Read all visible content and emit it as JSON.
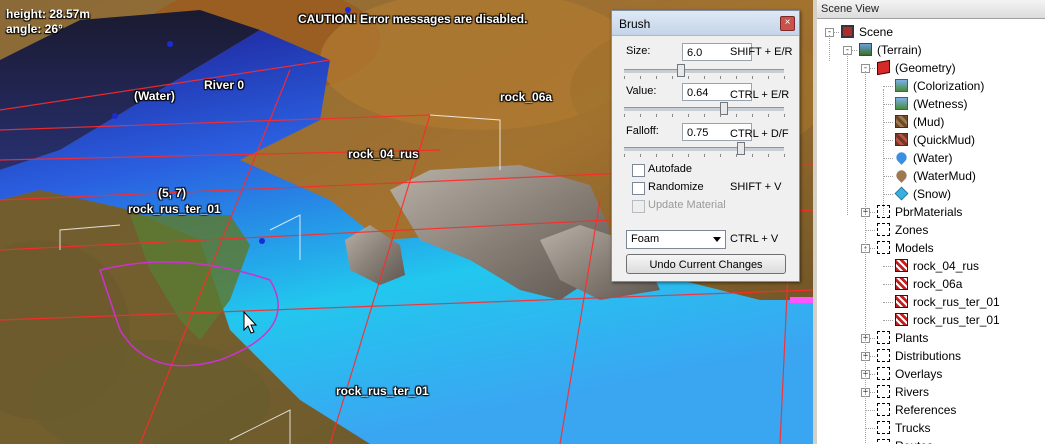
{
  "viewport": {
    "hud": {
      "height": "height: 28.57m",
      "angle": "angle: 26°"
    },
    "caution": "CAUTION! Error messages are disabled.",
    "labels": {
      "water": "(Water)",
      "river": "River 0",
      "rock_06a": "rock_06a",
      "rock_04_rus": "rock_04_rus",
      "coords": "(5, 7)",
      "rock_rus_ter_01_a": "rock_rus_ter_01",
      "rock_rus_ter_01_b": "rock_rus_ter_01"
    }
  },
  "brush": {
    "title": "Brush",
    "close": "×",
    "size": {
      "label": "Size:",
      "value": "6.0",
      "shortcut": "SHIFT + E/R",
      "level": 0.35
    },
    "value": {
      "label": "Value:",
      "value": "0.64",
      "shortcut": "CTRL + E/R",
      "level": 0.64
    },
    "falloff": {
      "label": "Falloff:",
      "value": "0.75",
      "shortcut": "CTRL + D/F",
      "level": 0.75
    },
    "autofade": {
      "label": "Autofade",
      "checked": false
    },
    "randomize": {
      "label": "Randomize",
      "checked": false,
      "shortcut": "SHIFT + V"
    },
    "update_material": {
      "label": "Update Material",
      "disabled": true
    },
    "material_select": {
      "value": "Foam",
      "shortcut": "CTRL + V"
    },
    "undo_button": "Undo Current Changes"
  },
  "scene_view": {
    "title": "Scene View",
    "items": [
      {
        "label": "Scene",
        "depth": 0,
        "expander": "-",
        "icon": "scene-icon"
      },
      {
        "label": "(Terrain)",
        "depth": 1,
        "expander": "-",
        "icon": "terrain-icon"
      },
      {
        "label": "(Geometry)",
        "depth": 2,
        "expander": "-",
        "icon": "geometry-cube-icon"
      },
      {
        "label": "(Colorization)",
        "depth": 3,
        "expander": "",
        "icon": "image-icon"
      },
      {
        "label": "(Wetness)",
        "depth": 3,
        "expander": "",
        "icon": "image-icon"
      },
      {
        "label": "(Mud)",
        "depth": 3,
        "expander": "",
        "icon": "mud-texture-icon"
      },
      {
        "label": "(QuickMud)",
        "depth": 3,
        "expander": "",
        "icon": "quickmud-texture-icon"
      },
      {
        "label": "(Water)",
        "depth": 3,
        "expander": "",
        "icon": "water-drop-icon"
      },
      {
        "label": "(WaterMud)",
        "depth": 3,
        "expander": "",
        "icon": "mud-drop-icon"
      },
      {
        "label": "(Snow)",
        "depth": 3,
        "expander": "",
        "icon": "snow-diamond-icon"
      },
      {
        "label": "PbrMaterials",
        "depth": 2,
        "expander": "+",
        "icon": "folder-icon"
      },
      {
        "label": "Zones",
        "depth": 2,
        "expander": "",
        "icon": "folder-icon"
      },
      {
        "label": "Models",
        "depth": 2,
        "expander": "-",
        "icon": "folder-icon"
      },
      {
        "label": "rock_04_rus",
        "depth": 3,
        "expander": "",
        "icon": "model-icon"
      },
      {
        "label": "rock_06a",
        "depth": 3,
        "expander": "",
        "icon": "model-icon"
      },
      {
        "label": "rock_rus_ter_01",
        "depth": 3,
        "expander": "",
        "icon": "model-icon"
      },
      {
        "label": "rock_rus_ter_01",
        "depth": 3,
        "expander": "",
        "icon": "model-icon"
      },
      {
        "label": "Plants",
        "depth": 2,
        "expander": "+",
        "icon": "folder-icon"
      },
      {
        "label": "Distributions",
        "depth": 2,
        "expander": "+",
        "icon": "folder-icon"
      },
      {
        "label": "Overlays",
        "depth": 2,
        "expander": "+",
        "icon": "folder-icon"
      },
      {
        "label": "Rivers",
        "depth": 2,
        "expander": "+",
        "icon": "folder-icon"
      },
      {
        "label": "References",
        "depth": 2,
        "expander": "",
        "icon": "folder-icon"
      },
      {
        "label": "Trucks",
        "depth": 2,
        "expander": "",
        "icon": "folder-icon"
      },
      {
        "label": "Routes",
        "depth": 2,
        "expander": "",
        "icon": "folder-icon"
      }
    ]
  }
}
